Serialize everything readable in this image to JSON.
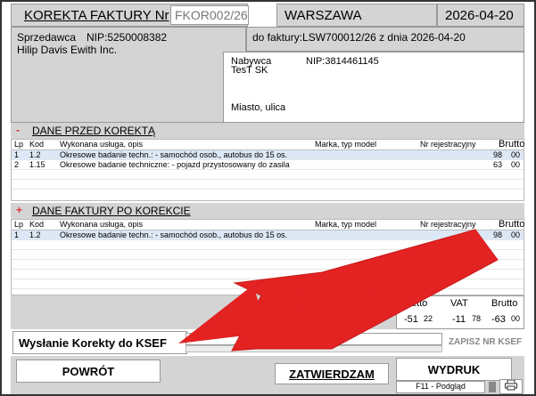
{
  "header": {
    "title": "KOREKTA FAKTURY Nr",
    "number": "FKOR002/26",
    "city": "WARSZAWA",
    "date": "2026-04-20"
  },
  "seller": {
    "label": "Sprzedawca",
    "nip": "NIP:5250008382",
    "name": "Hilip Davis Ewith Inc."
  },
  "invoice_ref": "do faktury:LSW700012/26 z dnia 2026-04-20",
  "buyer": {
    "label": "Nabywca",
    "nip": "NIP:3814461145",
    "name": "TesT SK",
    "address": "Miasto, ulica"
  },
  "section_before": {
    "marker": "-",
    "title": "DANE PRZED KOREKTĄ"
  },
  "section_after": {
    "marker": "+",
    "title": "DANE FAKTURY PO KOREKCIE"
  },
  "columns": {
    "lp": "Lp",
    "kod": "Kod",
    "opis": "Wykonana usługa, opis",
    "marka": "Marka, typ model",
    "rej": "Nr rejestracyjny",
    "brutto": "Brutto"
  },
  "rows_before": [
    {
      "lp": "1",
      "kod": "1.2",
      "opis": "Okresowe badanie techn.: - samochód osob., autobus do 15 os.",
      "brutto_zl": "98",
      "brutto_gr": "00"
    },
    {
      "lp": "2",
      "kod": "1.15",
      "opis": "Okresowe badanie techniczne: - pojazd przystosowany do zasila",
      "brutto_zl": "63",
      "brutto_gr": "00"
    }
  ],
  "rows_after": [
    {
      "lp": "1",
      "kod": "1.2",
      "opis": "Okresowe badanie techn.: - samochód osob., autobus do 15 os.",
      "brutto_zl": "98",
      "brutto_gr": "00"
    }
  ],
  "totals": {
    "netto_label": "Netto",
    "vat_label": "VAT",
    "brutto_label": "Brutto",
    "netto_zl": "-51",
    "netto_gr": "22",
    "vat_zl": "-11",
    "vat_gr": "78",
    "brutto_zl": "-63",
    "brutto_gr": "00"
  },
  "ksef": {
    "label": "Wysłanie Korekty do KSEF",
    "save_button": "ZAPISZ NR KSEF"
  },
  "buttons": {
    "back": "POWRÓT",
    "confirm": "ZATWIERDZAM",
    "print": "WYDRUK",
    "preview": "F11 - Podgląd"
  },
  "icons": {
    "print": "printer-icon",
    "arrow": "red-arrow-annotation"
  },
  "colors": {
    "panel": "#d4d4d4",
    "selected_row": "#dde8f6",
    "marker_red": "#e03030",
    "arrow_red": "#e32222"
  }
}
